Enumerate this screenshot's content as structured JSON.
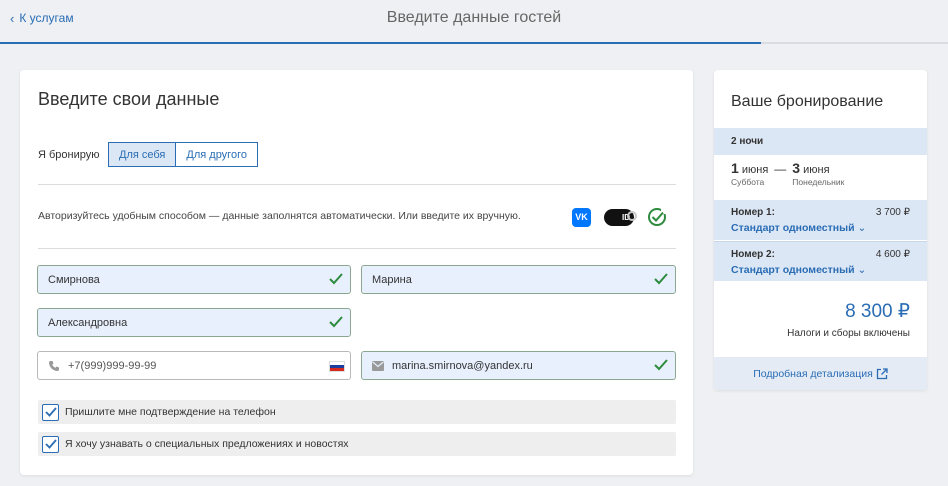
{
  "header": {
    "back_label": "К услугам",
    "title": "Введите данные гостей",
    "progress_fraction": 0.803
  },
  "form": {
    "title": "Введите свои данные",
    "booking_for_label": "Я бронирую",
    "booking_for_options": [
      {
        "label": "Для себя",
        "selected": true
      },
      {
        "label": "Для другого",
        "selected": false
      }
    ],
    "auth_text": "Авторизуйтесь удобным способом — данные заполнятся автоматически. Или введите их вручную.",
    "auth_icons": [
      "vk-icon",
      "sber-id-icon",
      "gosuslugi-check-icon"
    ],
    "vk_label": "VK",
    "sber_label": "ID",
    "last_name": "Смирнова",
    "first_name": "Марина",
    "middle_name": "Александровна",
    "phone_placeholder": "+7(999)999-99-99",
    "email": "marina.smirnova@yandex.ru",
    "checkboxes": [
      {
        "label": "Пришлите мне подтверждение на телефон",
        "checked": true
      },
      {
        "label": "Я хочу узнавать о специальных предложениях и новостях",
        "checked": true
      }
    ]
  },
  "summary": {
    "title": "Ваше бронирование",
    "nights": "2 ночи",
    "checkin_day": "1",
    "checkin_month": "июня",
    "checkin_weekday": "Суббота",
    "checkout_day": "3",
    "checkout_month": "июня",
    "checkout_weekday": "Понедельник",
    "date_separator": "—",
    "rooms": [
      {
        "label": "Номер 1:",
        "price": "3 700 ₽",
        "type": "Стандарт одноместный"
      },
      {
        "label": "Номер 2:",
        "price": "4 600 ₽",
        "type": "Стандарт одноместный"
      }
    ],
    "total": "8 300 ₽",
    "taxes_note": "Налоги и сборы включены",
    "details_link": "Подробная детализация"
  },
  "colors": {
    "accent": "#2a6db5",
    "success": "#2e8b3e",
    "field_fill": "#e8f0fe",
    "highlight": "#dce7f5"
  }
}
